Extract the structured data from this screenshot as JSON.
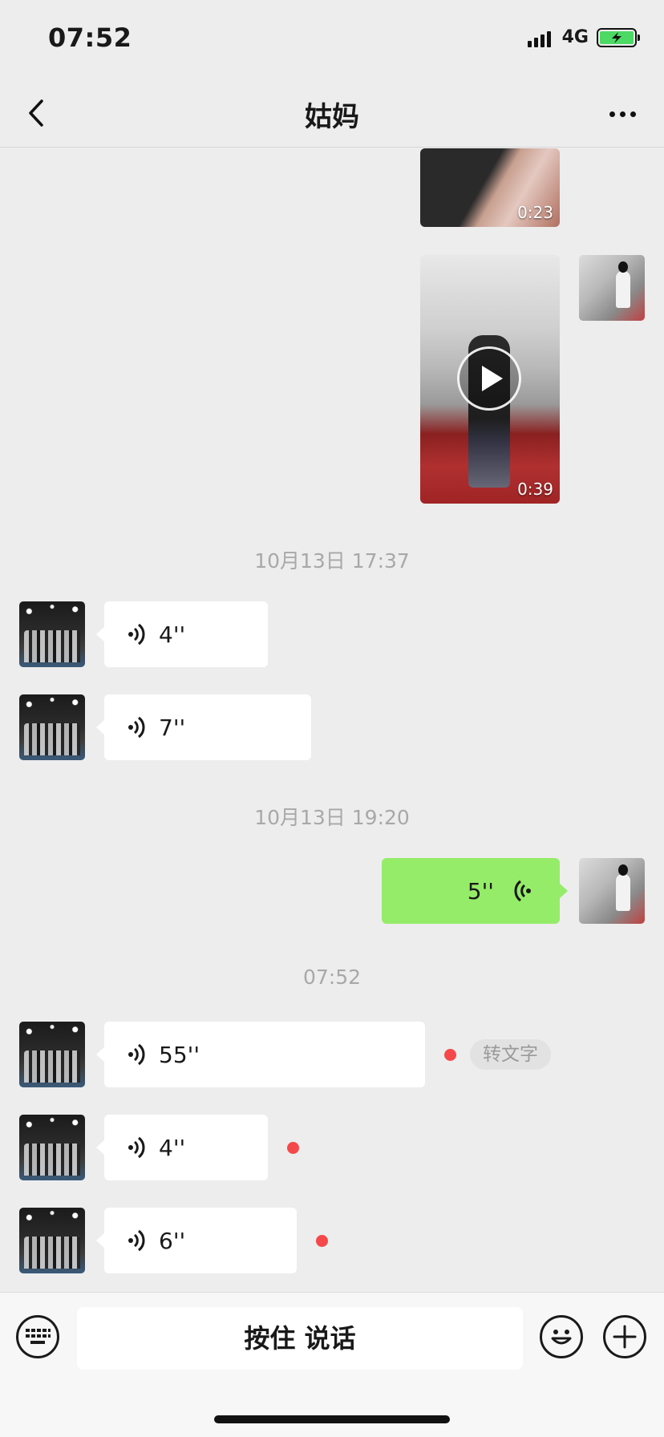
{
  "status_bar": {
    "time": "07:52",
    "network": "4G"
  },
  "nav": {
    "title": "姑妈",
    "back_icon": "chevron-left-icon",
    "more_icon": "more-dots-icon"
  },
  "messages": {
    "video_1": {
      "duration": "0:23"
    },
    "video_2": {
      "duration": "0:39"
    },
    "ts_1": "10月13日 17:37",
    "voice_1": {
      "length": "4''"
    },
    "voice_2": {
      "length": "7''"
    },
    "ts_2": "10月13日 19:20",
    "voice_me": {
      "length": "5''"
    },
    "ts_3": "07:52",
    "voice_3": {
      "length": "55''",
      "to_text": "转文字"
    },
    "voice_4": {
      "length": "4''"
    },
    "voice_5": {
      "length": "6''"
    }
  },
  "input_bar": {
    "hold_to_talk": "按住 说话",
    "keyboard_icon": "keyboard-icon",
    "emoji_icon": "emoji-icon",
    "plus_icon": "plus-icon"
  },
  "colors": {
    "background": "#ededed",
    "my_bubble": "#95ec69",
    "their_bubble": "#ffffff",
    "unread_dot": "#f5484a"
  }
}
